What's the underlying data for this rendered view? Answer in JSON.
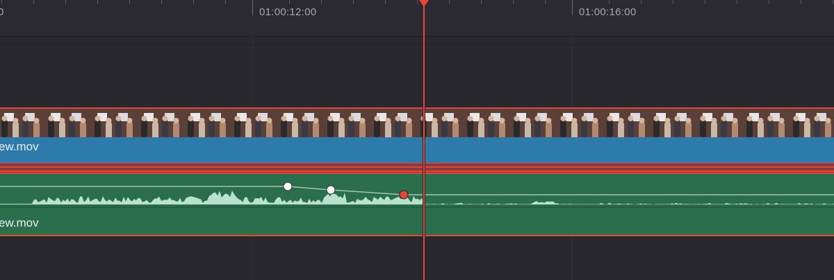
{
  "ruler": {
    "timecodes": [
      "0",
      "01:00:12:00",
      "01:00:16:00"
    ]
  },
  "tracks": {
    "video": {
      "clip_name": "ew.mov",
      "color": "#2e7bab"
    },
    "audio": {
      "clip_name": "ew.mov",
      "color": "#2a6e4c"
    }
  },
  "colors": {
    "selection": "#e8443a",
    "playhead": "#e8443a",
    "waveform": "#bfe8d2",
    "background": "#28282e"
  },
  "playhead": {
    "timecode_position": "between 01:00:12:00 and 01:00:16:00"
  },
  "keyframes": [
    {
      "state": "normal"
    },
    {
      "state": "normal"
    },
    {
      "state": "selected"
    }
  ]
}
